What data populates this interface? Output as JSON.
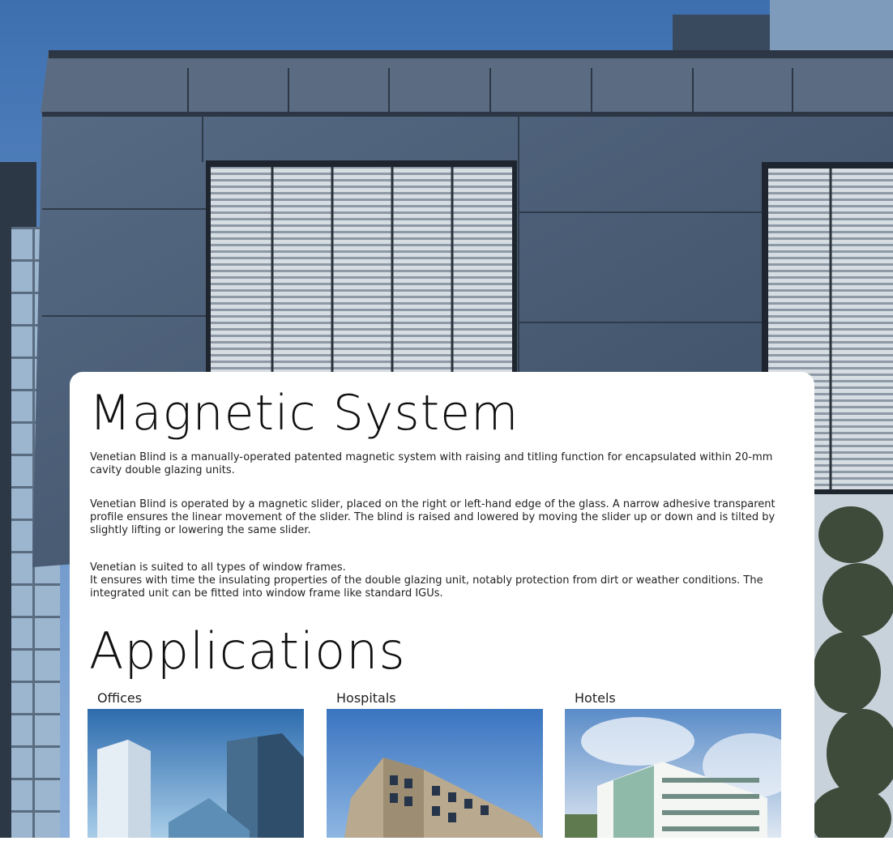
{
  "magnetic": {
    "title": "Magnetic System",
    "paragraphs": [
      "Venetian Blind is a manually-operated patented magnetic system with raising and titling function for encapsulated within 20-mm cavity double glazing units.",
      "Venetian Blind is operated by a magnetic slider, placed on the right or left-hand edge of the glass. A narrow adhesive transparent profile ensures the linear movement of the slider. The blind is raised and lowered by moving the slider up or down and is tilted by slightly lifting or lowering the same slider.",
      "Venetian is suited to all types of window frames.\nIt ensures with time the insulating properties of the double glazing unit, notably protection from dirt or weather conditions. The integrated unit can be fitted into window frame like standard IGUs."
    ]
  },
  "applications": {
    "title": "Applications",
    "items": [
      {
        "label": "Offices"
      },
      {
        "label": "Hospitals"
      },
      {
        "label": "Hotels"
      }
    ]
  },
  "colors": {
    "sky": "#4a78b8",
    "facade": "#4a5e78",
    "panel": "#ffffff",
    "text": "#222222"
  }
}
